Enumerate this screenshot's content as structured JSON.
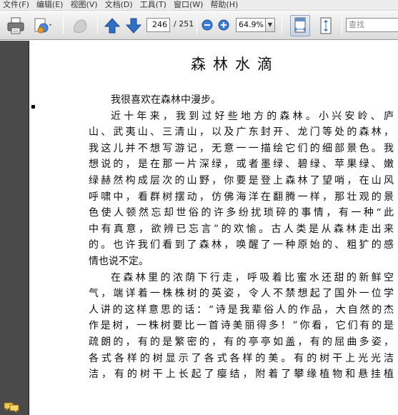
{
  "menu": {
    "items": [
      "文件(F)",
      "编辑(E)",
      "视图(V)",
      "文档(D)",
      "工具(T)",
      "窗口(W)",
      "帮助(H)"
    ]
  },
  "toolbar": {
    "page_current": "246",
    "page_total": "/ 251",
    "zoom_value": "64.9%",
    "search_placeholder": "查找"
  },
  "colors": {
    "arrow_blue": "#2f6fc4",
    "side_panel": "#4a4a4a",
    "page_bg": "#ffffff"
  },
  "document": {
    "title": "森林水滴",
    "lines": [
      "我很喜欢在森林中漫步。",
      "近十年来，我到过好些地方的森林。小兴安岭、庐",
      "山、武夷山、三清山，以及广东封开、龙门等处的森林，",
      "我这儿并不想写游记，无意一一描绘它们的细部景色。我",
      "想说的，是在那一片深绿，或者墨绿、碧绿、苹果绿、嫩",
      "绿赫然构成层次的山野，你要是登上森林了望哨，在山风",
      "呼啸中，看群树摆动，仿佛海洋在翻腾一样，那壮观的景",
      "色使人顿然忘却世俗的许多纷扰琐碎的事情，有一种“此",
      "中有真意，欲辨已忘言”的欢愉。古人类是从森林走出来",
      "的。也许我们看到了森林，唤醒了一种原始的、粗犷的感",
      "情也说不定。",
      "在森林里的浓荫下行走，呼吸着比蜜水还甜的新鲜空",
      "气，端详着一株株树的英姿，令人不禁想起了国外一位学",
      "人讲的这样意思的话：“诗是我辈俗人的作品，大自然的杰",
      "作是树，一株树要比一首诗美丽得多！”你看，它们有的是",
      "疏朗的，有的是繁密的，有的亭亭如盖，有的屈曲多姿，",
      "各式各样的树显示了各式各样的美。有的树干上光光洁",
      "洁，有的树干上长起了瘿结，附着了攀缘植物和悬挂植"
    ]
  }
}
